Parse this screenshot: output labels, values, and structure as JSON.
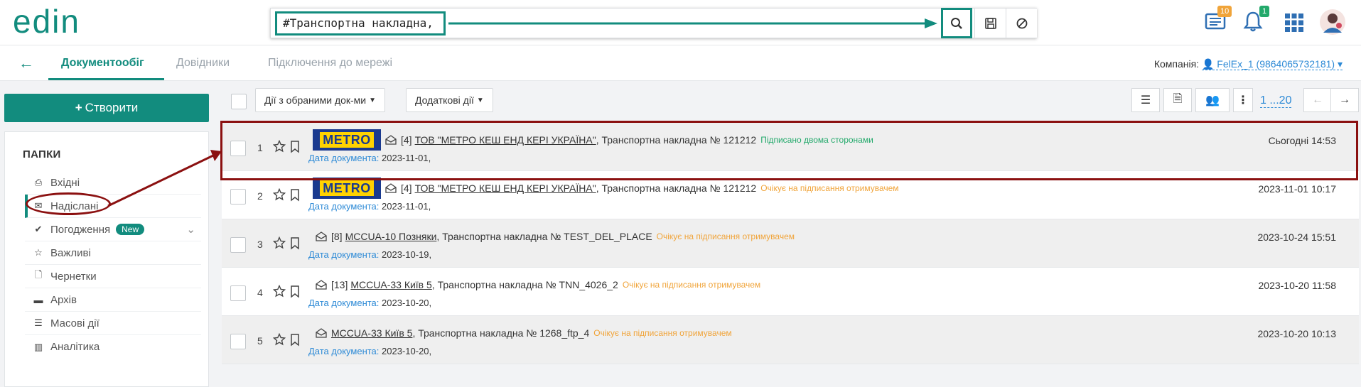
{
  "header": {
    "logo_text": "edin",
    "search": {
      "value": "#Транспортна накладна,"
    },
    "news_badge": "10",
    "bell_badge": "1"
  },
  "nav": {
    "back_icon": "arrow-left-icon",
    "tabs": [
      {
        "label": "Документообіг",
        "active": true
      },
      {
        "label": "Довідники",
        "active": false
      },
      {
        "label": "Підключення до мережі",
        "active": false
      }
    ],
    "company_label": "Компанія:",
    "company_value": "FelEx_1 (9864065732181)"
  },
  "sidebar": {
    "create_label": "Створити",
    "folders_title": "ПАПКИ",
    "items": [
      {
        "label": "Вхідні",
        "icon": "inbox-icon"
      },
      {
        "label": "Надіслані",
        "icon": "envelope-icon",
        "active": true
      },
      {
        "label": "Погодження",
        "icon": "check-icon",
        "badge": "New"
      },
      {
        "label": "Важливі",
        "icon": "star-icon"
      },
      {
        "label": "Чернетки",
        "icon": "draft-icon"
      },
      {
        "label": "Архів",
        "icon": "archive-icon"
      },
      {
        "label": "Масові дії",
        "icon": "bulk-icon"
      },
      {
        "label": "Аналітика",
        "icon": "chart-icon"
      }
    ]
  },
  "toolbar": {
    "actions_label": "Дії з обраними док-ми",
    "extra_label": "Додаткові дії",
    "pager": "1 ...20"
  },
  "documents": [
    {
      "num": "1",
      "logo": "METRO",
      "count": "[4]",
      "company": "ТОВ \"МЕТРО КЕШ ЕНД КЕРІ УКРАЇНА\"",
      "title": ", Транспортна накладна № 121212",
      "status": "Підписано двома сторонами",
      "status_color": "green",
      "date_label": "Дата документа:",
      "doc_date": "2023-11-01,",
      "time": "Сьогодні 14:53"
    },
    {
      "num": "2",
      "logo": "METRO",
      "count": "[4]",
      "company": "ТОВ \"МЕТРО КЕШ ЕНД КЕРІ УКРАЇНА\"",
      "title": ", Транспортна накладна № 121212",
      "status": "Очікує на підписання отримувачем",
      "status_color": "orange",
      "date_label": "Дата документа:",
      "doc_date": "2023-11-01,",
      "time": "2023-11-01 10:17"
    },
    {
      "num": "3",
      "logo": "",
      "count": "[8]",
      "company": "MCCUA-10 Позняки",
      "title": ", Транспортна накладна № TEST_DEL_PLACE",
      "status": "Очікує на підписання отримувачем",
      "status_color": "orange",
      "date_label": "Дата документа:",
      "doc_date": "2023-10-19,",
      "time": "2023-10-24 15:51"
    },
    {
      "num": "4",
      "logo": "",
      "count": "[13]",
      "company": "MCCUA-33 Київ 5",
      "title": ", Транспортна накладна № TNN_4026_2",
      "status": "Очікує на підписання отримувачем",
      "status_color": "orange",
      "date_label": "Дата документа:",
      "doc_date": "2023-10-20,",
      "time": "2023-10-20 11:58"
    },
    {
      "num": "5",
      "logo": "",
      "count": "",
      "company": "MCCUA-33 Київ 5",
      "title": ", Транспортна накладна № 1268_ftp_4",
      "status": "Очікує на підписання отримувачем",
      "status_color": "orange",
      "date_label": "Дата документа:",
      "doc_date": "2023-10-20,",
      "time": "2023-10-20 10:13"
    }
  ],
  "colors": {
    "accent": "#128c7e",
    "link": "#2d8ad6",
    "annotation": "#8b1010",
    "green_status": "#23a96b",
    "orange_status": "#f0a43a"
  }
}
